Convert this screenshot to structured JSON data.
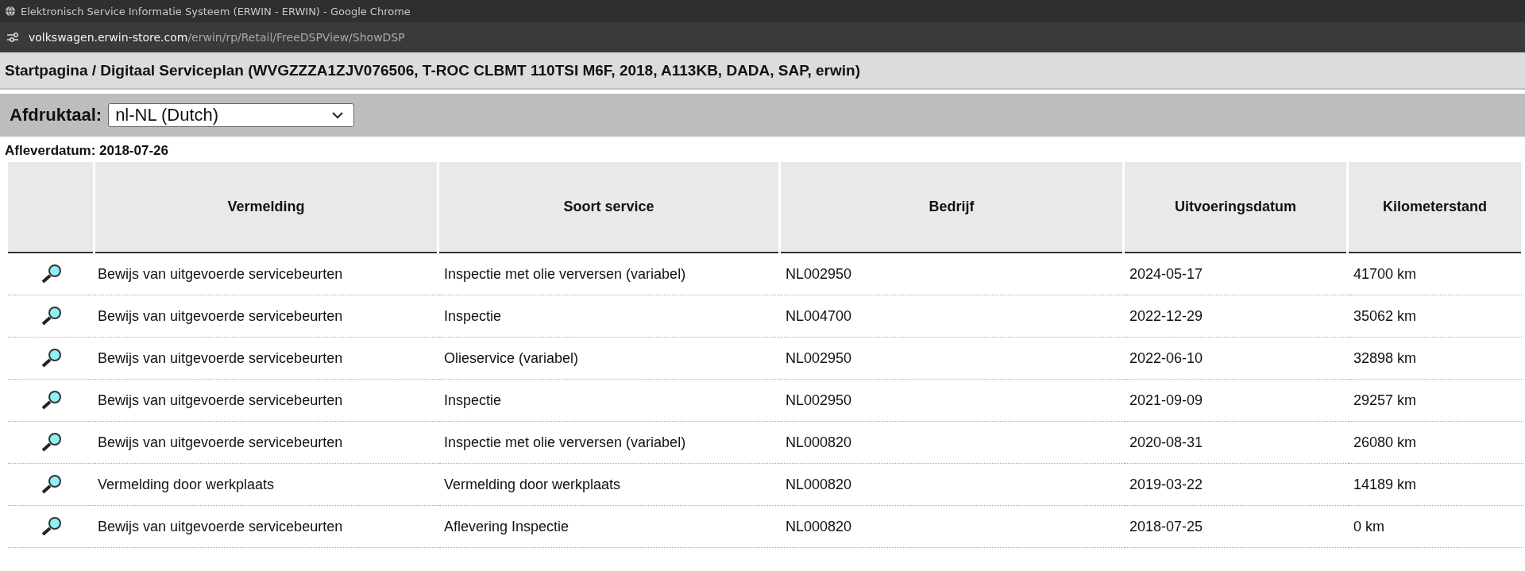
{
  "browser": {
    "tab_title": "Elektronisch Service Informatie Systeem (ERWIN - ERWIN) - Google Chrome",
    "url_host": "volkswagen.erwin-store.com",
    "url_path": "/erwin/rp/Retail/FreeDSPView/ShowDSP"
  },
  "breadcrumb": "Startpagina / Digitaal Serviceplan (WVGZZZA1ZJV076506, T-ROC CLBMT 110TSI M6F, 2018, A113KB, DADA, SAP, erwin)",
  "print_language": {
    "label": "Afdruktaal:",
    "value": "nl-NL (Dutch)"
  },
  "delivery_date": "Afleverdatum: 2018-07-26",
  "table": {
    "columns": [
      "Vermelding",
      "Soort service",
      "Bedrijf",
      "Uitvoeringsdatum",
      "Kilometerstand"
    ],
    "rows": [
      {
        "cells": [
          "Bewijs van uitgevoerde servicebeurten",
          "Inspectie met olie verversen (variabel)",
          "NL002950",
          "2024-05-17",
          "41700 km"
        ]
      },
      {
        "cells": [
          "Bewijs van uitgevoerde servicebeurten",
          "Inspectie",
          "NL004700",
          "2022-12-29",
          "35062 km"
        ]
      },
      {
        "cells": [
          "Bewijs van uitgevoerde servicebeurten",
          "Olieservice (variabel)",
          "NL002950",
          "2022-06-10",
          "32898 km"
        ]
      },
      {
        "cells": [
          "Bewijs van uitgevoerde servicebeurten",
          "Inspectie",
          "NL002950",
          "2021-09-09",
          "29257 km"
        ]
      },
      {
        "cells": [
          "Bewijs van uitgevoerde servicebeurten",
          "Inspectie met olie verversen (variabel)",
          "NL000820",
          "2020-08-31",
          "26080 km"
        ]
      },
      {
        "cells": [
          "Vermelding door werkplaats",
          "Vermelding door werkplaats",
          "NL000820",
          "2019-03-22",
          "14189 km"
        ]
      },
      {
        "cells": [
          "Bewijs van uitgevoerde servicebeurten",
          "Aflevering Inspectie",
          "NL000820",
          "2018-07-25",
          "0 km"
        ]
      }
    ]
  }
}
